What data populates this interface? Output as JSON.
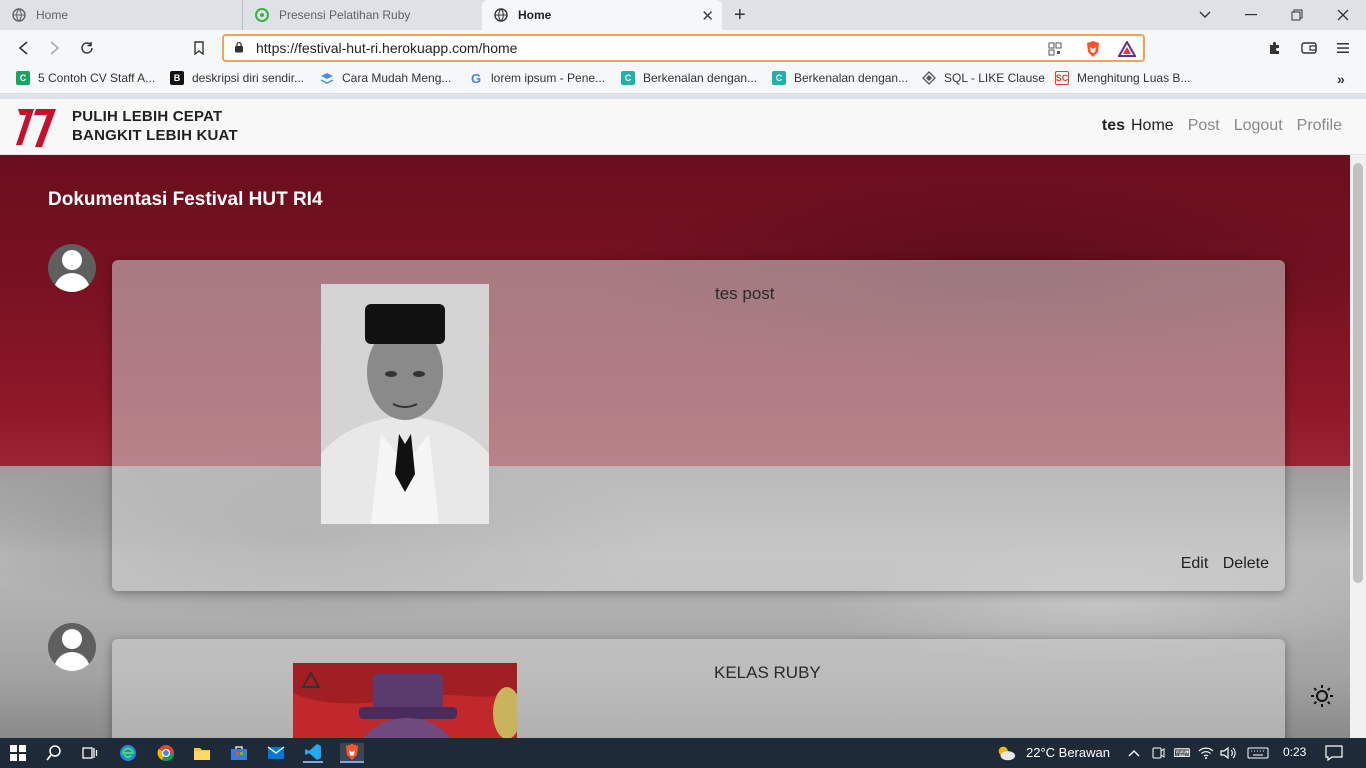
{
  "browser": {
    "tabs": [
      {
        "label": "Home",
        "active": false
      },
      {
        "label": "Presensi Pelatihan Ruby",
        "active": false
      },
      {
        "label": "Home",
        "active": true
      }
    ],
    "url": "https://festival-hut-ri.herokuapp.com/home",
    "bookmarks": [
      {
        "label": "5 Contoh CV Staff A...",
        "icon": "green-c-icon",
        "color": "#1aa260"
      },
      {
        "label": "deskripsi diri sendir...",
        "icon": "b-icon",
        "color": "#111111"
      },
      {
        "label": "Cara Mudah Meng...",
        "icon": "stack-icon",
        "color": "#4a90d9"
      },
      {
        "label": "lorem ipsum - Pene...",
        "icon": "google-g-icon",
        "color": "#4285f4"
      },
      {
        "label": "Berkenalan dengan...",
        "icon": "teal-c-icon",
        "color": "#20b2aa"
      },
      {
        "label": "Berkenalan dengan...",
        "icon": "teal-c-icon",
        "color": "#20b2aa"
      },
      {
        "label": "SQL - LIKE Clause",
        "icon": "diamond-icon",
        "color": "#555555"
      },
      {
        "label": "Menghitung Luas B...",
        "icon": "sc-icon",
        "color": "#e53935"
      }
    ]
  },
  "site": {
    "brand_line1": "PULIH LEBIH CEPAT",
    "brand_line2": "BANGKIT LEBIH KUAT",
    "logo_text": "77",
    "nav": {
      "user": "tes",
      "home": "Home",
      "post": "Post",
      "logout": "Logout",
      "profile": "Profile"
    },
    "page_title": "Dokumentasi Festival HUT RI4",
    "posts": [
      {
        "caption": "tes post",
        "edit_label": "Edit",
        "delete_label": "Delete"
      },
      {
        "caption": "KELAS RUBY"
      }
    ]
  },
  "taskbar": {
    "weather": "22°C  Berawan",
    "time": "0:23"
  },
  "colors": {
    "red": "#8e1828",
    "accent_url": "#f0a15a",
    "taskbar": "#1f2a38"
  }
}
